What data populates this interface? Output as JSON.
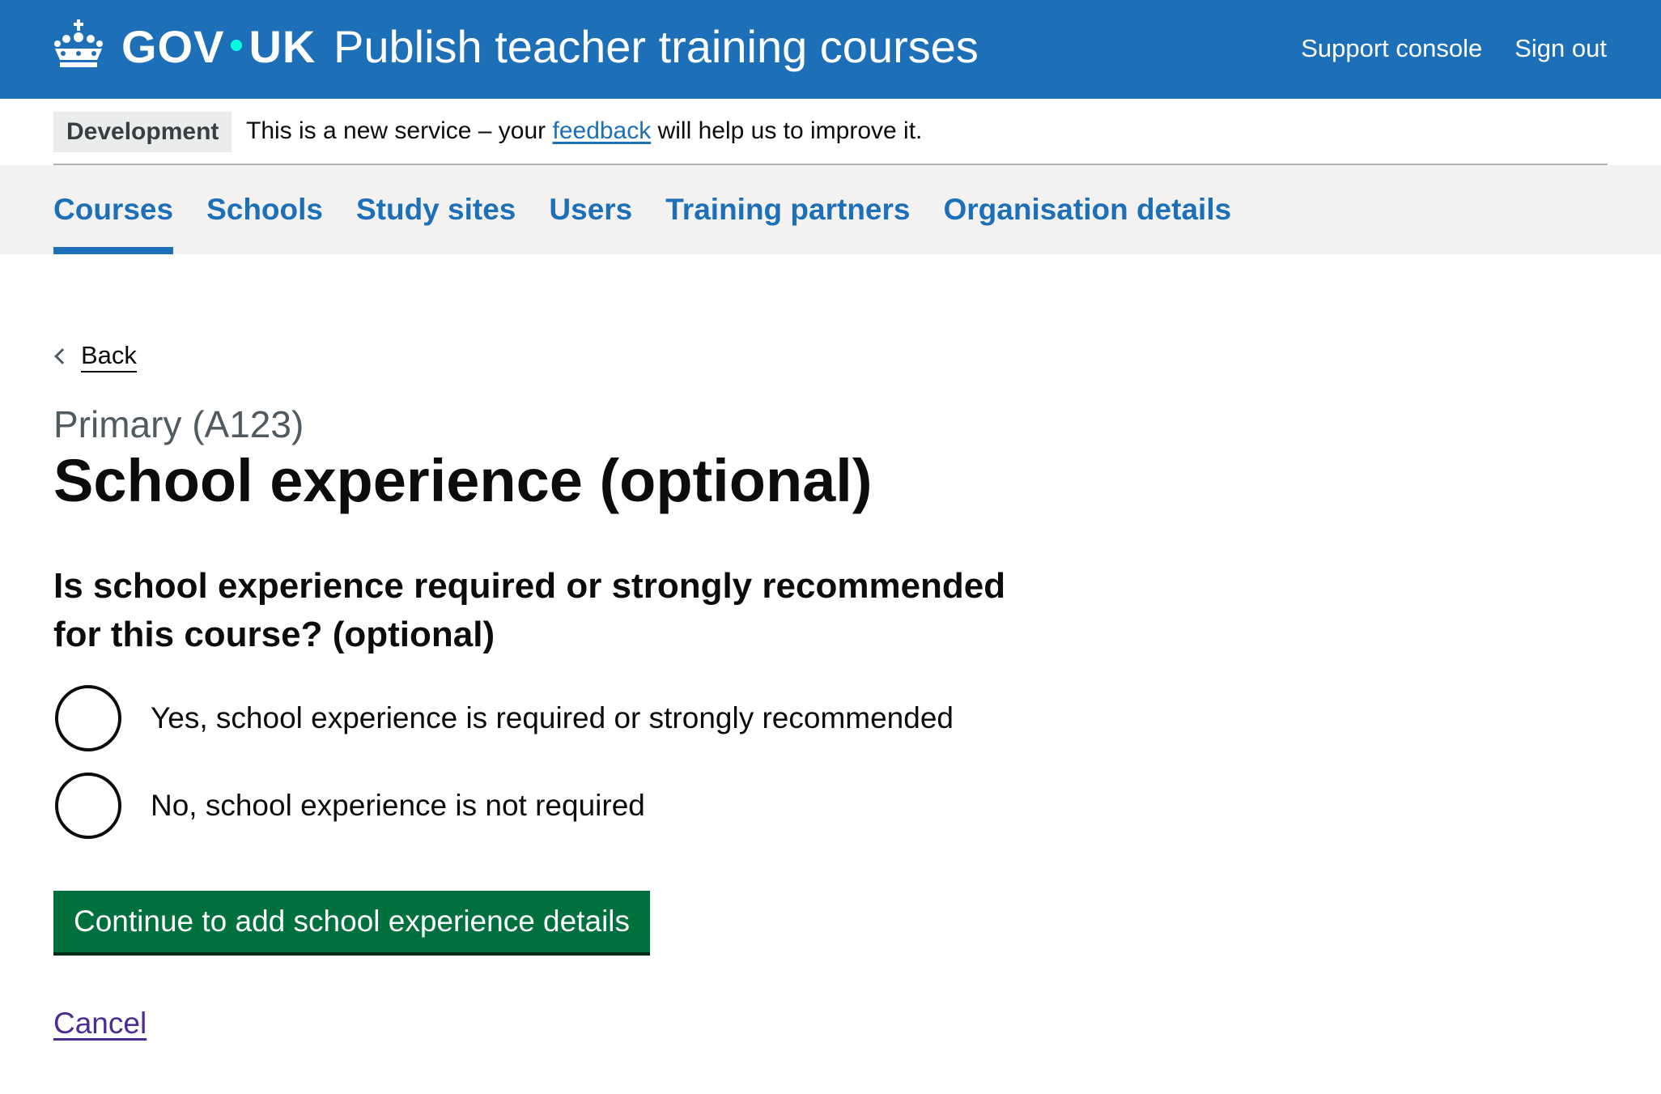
{
  "header": {
    "logo_text": "GOV",
    "logo_text_2": "UK",
    "service_name": "Publish teacher training courses",
    "nav": [
      {
        "label": "Support console"
      },
      {
        "label": "Sign out"
      }
    ],
    "crown_icon": "crown-icon"
  },
  "phase_banner": {
    "tag": "Development",
    "text_before": "This is a new service – your ",
    "link": "feedback",
    "text_after": " will help us to improve it."
  },
  "subnav": {
    "items": [
      {
        "label": "Courses",
        "active": true
      },
      {
        "label": "Schools"
      },
      {
        "label": "Study sites"
      },
      {
        "label": "Users"
      },
      {
        "label": "Training partners"
      },
      {
        "label": "Organisation details"
      }
    ]
  },
  "main": {
    "back_label": "Back",
    "caption": "Primary (A123)",
    "title": "School experience (optional)",
    "question": "Is school experience required or strongly recommended for this course? (optional)",
    "options": [
      {
        "label": "Yes, school experience is required or strongly recommended",
        "selected": false
      },
      {
        "label": "No, school experience is not required",
        "selected": false
      }
    ],
    "continue_label": "Continue to add school experience details",
    "cancel_label": "Cancel"
  },
  "colors": {
    "brand_blue": "#1d70b8",
    "button_green": "#00703c",
    "visited_link": "#4c2c92",
    "subnav_bg": "#f3f2f1"
  }
}
